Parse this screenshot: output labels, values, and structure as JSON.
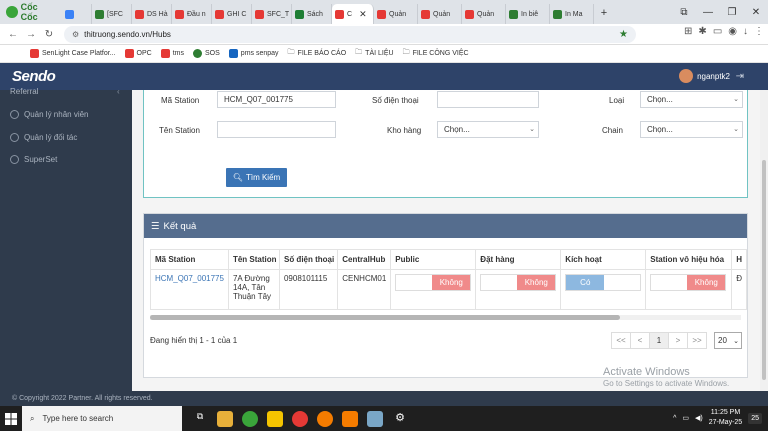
{
  "browser": {
    "brand": "Cốc Cốc",
    "tabs": [
      {
        "label": "",
        "color": "#3b82f6"
      },
      {
        "label": "[SFC",
        "color": "#2e7d32"
      },
      {
        "label": "DS Hà",
        "color": "#e53935"
      },
      {
        "label": "Đầu n",
        "color": "#e53935"
      },
      {
        "label": "GHI C",
        "color": "#e53935"
      },
      {
        "label": "SFC_T",
        "color": "#e53935"
      },
      {
        "label": "Sách",
        "color": "#1e7e34"
      },
      {
        "label": "C",
        "color": "#e53935",
        "active": true
      },
      {
        "label": "Quản",
        "color": "#e53935"
      },
      {
        "label": "Quản",
        "color": "#e53935"
      },
      {
        "label": "Quản",
        "color": "#e53935"
      },
      {
        "label": "In biê",
        "color": "#2e7d32"
      },
      {
        "label": "In Ma",
        "color": "#2e7d32"
      }
    ],
    "new_tab": "+",
    "url": "thitruong.sendo.vn/Hubs",
    "bookmarks": [
      "SenLight Case Platfor...",
      "OPC",
      "tms",
      "SOS",
      "pms senpay",
      "FILE BÁO CÁO",
      "TÀI LIỆU",
      "FILE CÔNG VIỆC"
    ]
  },
  "app": {
    "brand": "Sendo",
    "username": "nganptk2"
  },
  "sidebar": {
    "items": [
      {
        "label": "Referral"
      },
      {
        "label": "Quản lý nhân viên"
      },
      {
        "label": "Quản lý đối tác"
      },
      {
        "label": "SuperSet"
      }
    ]
  },
  "search": {
    "station_code_label": "Mã Station",
    "station_code_value": "HCM_Q07_001775",
    "phone_label": "Số điện thoại",
    "phone_value": "",
    "type_label": "Loại",
    "type_value": "Chọn...",
    "station_name_label": "Tên Station",
    "station_name_value": "",
    "warehouse_label": "Kho hàng",
    "warehouse_value": "Chọn...",
    "chain_label": "Chain",
    "chain_value": "Chọn...",
    "search_button": "Tìm Kiếm"
  },
  "results": {
    "title": "Kết quả",
    "columns": [
      "Mã Station",
      "Tên Station",
      "Số điện thoại",
      "CentralHub",
      "Public",
      "Đặt hàng",
      "Kích hoạt",
      "Station vô hiệu hóa",
      "H"
    ],
    "rows": [
      {
        "code": "HCM_Q07_001775",
        "name": "7A Đường 14A, Tân Thuận Tây",
        "phone": "0908101115",
        "hub": "CENHCM01",
        "public": "Không",
        "order": "Không",
        "active": "Có",
        "disabled": "Không",
        "extra": "Đ"
      }
    ],
    "page_info": "Đang hiển thị 1 - 1 của 1",
    "pager": [
      "<<",
      "<",
      "1",
      ">",
      ">>"
    ],
    "page_size": "20"
  },
  "colors": {
    "header": "#2e4369",
    "sidebar": "#2f3b4c",
    "toggle_no": "#f08a8a",
    "toggle_yes": "#8db8e0",
    "button": "#3a74b5"
  },
  "footer": "© Copyright 2022 Partner. All rights reserved.",
  "watermark": {
    "title": "Activate Windows",
    "subtitle": "Go to Settings to activate Windows."
  },
  "taskbar": {
    "search_placeholder": "Type here to search",
    "time": "11:25 PM",
    "date": "27-May-25",
    "notification_count": "25"
  }
}
